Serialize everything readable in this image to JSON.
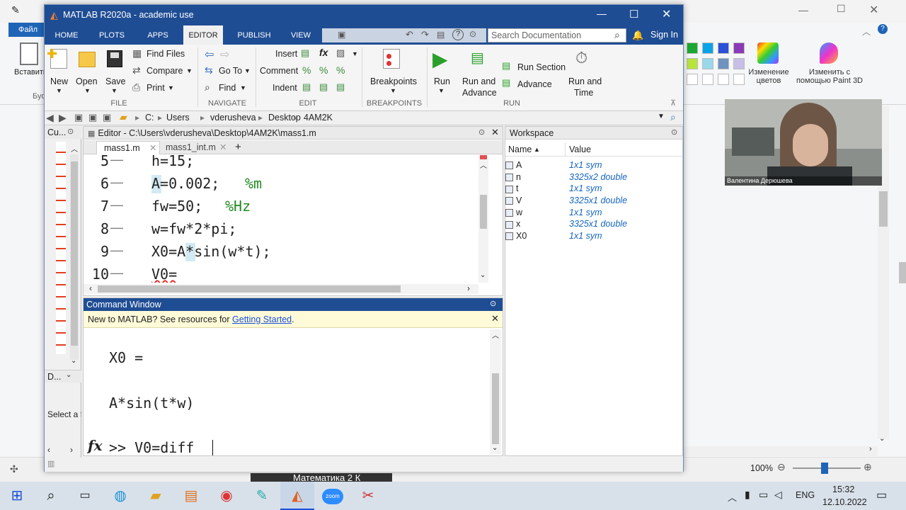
{
  "paint": {
    "file_tab": "Файл",
    "paste_label": "Вставить",
    "buffer_label": "Буф",
    "edit_colors": "Изменение цветов",
    "paint3d": "Изменить с помощью Paint 3D",
    "zoom": "100%",
    "palette": [
      "#1aa832",
      "#0aa3e8",
      "#2b4fd8",
      "#8b3bb7",
      "#b8e43c",
      "#99d9ea",
      "#7092be",
      "#c8bfe7"
    ]
  },
  "webcam": {
    "name": "Валентина Дерюшева"
  },
  "matlab": {
    "title": "MATLAB R2020a - academic use",
    "tabs": [
      "HOME",
      "PLOTS",
      "APPS",
      "EDITOR",
      "PUBLISH",
      "VIEW"
    ],
    "search_placeholder": "Search Documentation",
    "sign_in": "Sign In",
    "ribbon": {
      "file": {
        "new": "New",
        "open": "Open",
        "save": "Save",
        "find_files": "Find Files",
        "compare": "Compare",
        "print": "Print",
        "label": "FILE"
      },
      "navigate": {
        "goto": "Go To",
        "find": "Find",
        "label": "NAVIGATE"
      },
      "edit": {
        "insert": "Insert",
        "comment": "Comment",
        "indent": "Indent",
        "label": "EDIT"
      },
      "breakpoints": {
        "btn": "Breakpoints",
        "label": "BREAKPOINTS"
      },
      "run": {
        "run": "Run",
        "run_advance_1": "Run and",
        "run_advance_2": "Advance",
        "run_section": "Run Section",
        "advance": "Advance",
        "run_time_1": "Run and",
        "run_time_2": "Time",
        "label": "RUN"
      }
    },
    "path": [
      "C:",
      "Users",
      "vderusheva",
      "Desktop",
      "4AM2K"
    ],
    "current_folder_label": "Cu...",
    "details_label": "D...",
    "select_text": "Select a f",
    "editor": {
      "title": "Editor - C:\\Users\\vderusheva\\Desktop\\4AM2K\\mass1.m",
      "tabs": [
        "mass1.m",
        "mass1_int.m"
      ],
      "lines": [
        {
          "n": "5",
          "code": "h=15;"
        },
        {
          "n": "6",
          "code": "A=0.002;",
          "comment": "%m"
        },
        {
          "n": "7",
          "code": "fw=50;",
          "comment": "%Hz"
        },
        {
          "n": "8",
          "code": "w=fw*2*pi;"
        },
        {
          "n": "9",
          "code": "X0=A*sin(w*t);"
        },
        {
          "n": "10",
          "code": "V0="
        }
      ]
    },
    "command": {
      "title": "Command Window",
      "banner_text": "New to MATLAB? See resources for ",
      "banner_link": "Getting Started",
      "banner_end": ".",
      "out1": "X0 =",
      "out2": "A*sin(t*w)",
      "prompt": ">> V0=diff"
    },
    "workspace": {
      "title": "Workspace",
      "col_name": "Name",
      "col_value": "Value",
      "rows": [
        {
          "name": "A",
          "value": "1x1 sym"
        },
        {
          "name": "n",
          "value": "3325x2 double"
        },
        {
          "name": "t",
          "value": "1x1 sym"
        },
        {
          "name": "V",
          "value": "3325x1 double"
        },
        {
          "name": "w",
          "value": "1x1 sym"
        },
        {
          "name": "x",
          "value": "3325x1 double"
        },
        {
          "name": "X0",
          "value": "1x1 sym"
        }
      ]
    }
  },
  "behind_text": "Математика 2 К",
  "taskbar": {
    "lang": "ENG",
    "time": "15:32",
    "date": "12.10.2022"
  }
}
